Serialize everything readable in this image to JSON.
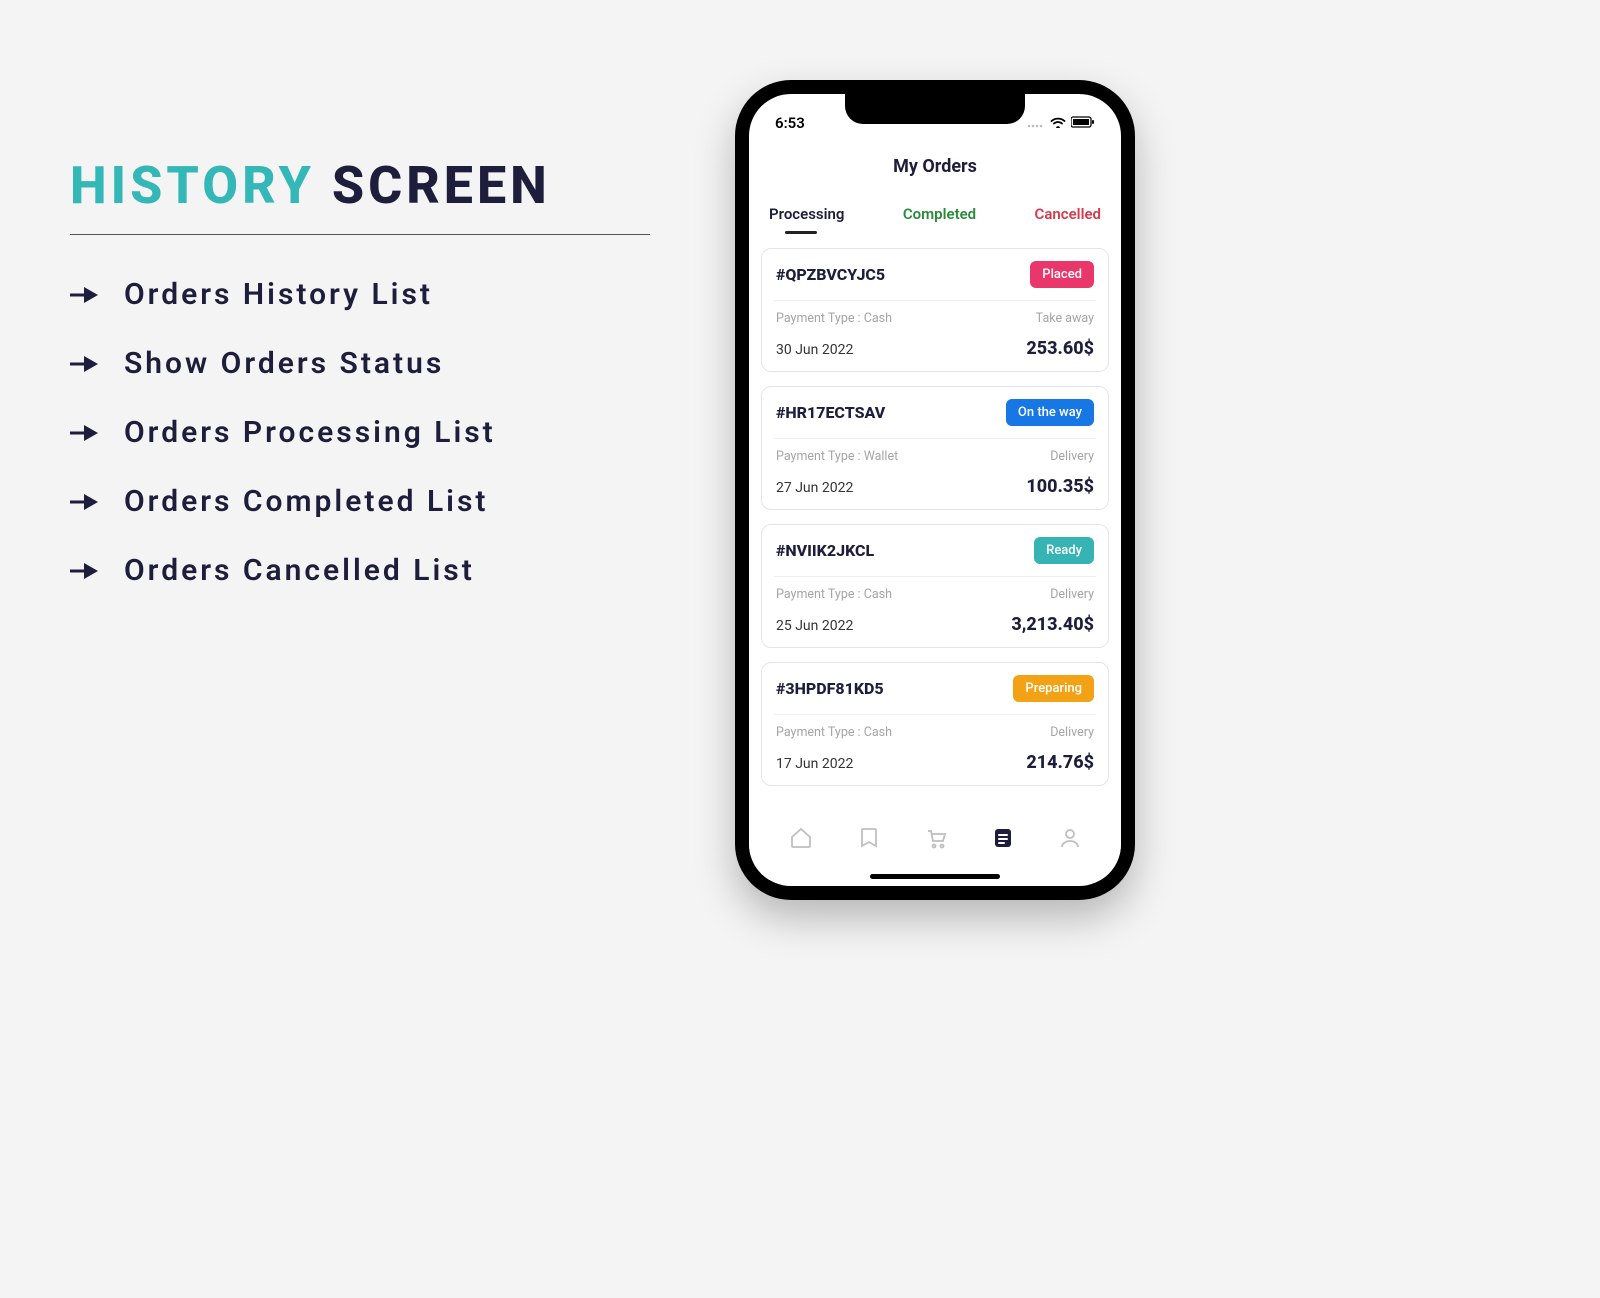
{
  "left": {
    "title_accent": "HISTORY",
    "title_dark": "SCREEN",
    "bullets": [
      "Orders History List",
      "Show Orders Status",
      "Orders Processing List",
      "Orders Completed List",
      "Orders Cancelled List"
    ]
  },
  "status": {
    "time": "6:53"
  },
  "page_title": "My Orders",
  "tabs": {
    "processing": "Processing",
    "completed": "Completed",
    "cancelled": "Cancelled"
  },
  "labels": {
    "payment_prefix": "Payment Type : "
  },
  "orders": [
    {
      "id": "#QPZBVCYJC5",
      "status": "Placed",
      "status_class": "badge-placed",
      "payment": "Cash",
      "mode": "Take away",
      "date": "30 Jun 2022",
      "price": "253.60$"
    },
    {
      "id": "#HR17ECTSAV",
      "status": "On the way",
      "status_class": "badge-ontheway",
      "payment": "Wallet",
      "mode": "Delivery",
      "date": "27 Jun 2022",
      "price": "100.35$"
    },
    {
      "id": "#NVIIK2JKCL",
      "status": "Ready",
      "status_class": "badge-ready",
      "payment": "Cash",
      "mode": "Delivery",
      "date": "25 Jun 2022",
      "price": "3,213.40$"
    },
    {
      "id": "#3HPDF81KD5",
      "status": "Preparing",
      "status_class": "badge-preparing",
      "payment": "Cash",
      "mode": "Delivery",
      "date": "17 Jun 2022",
      "price": "214.76$"
    }
  ]
}
